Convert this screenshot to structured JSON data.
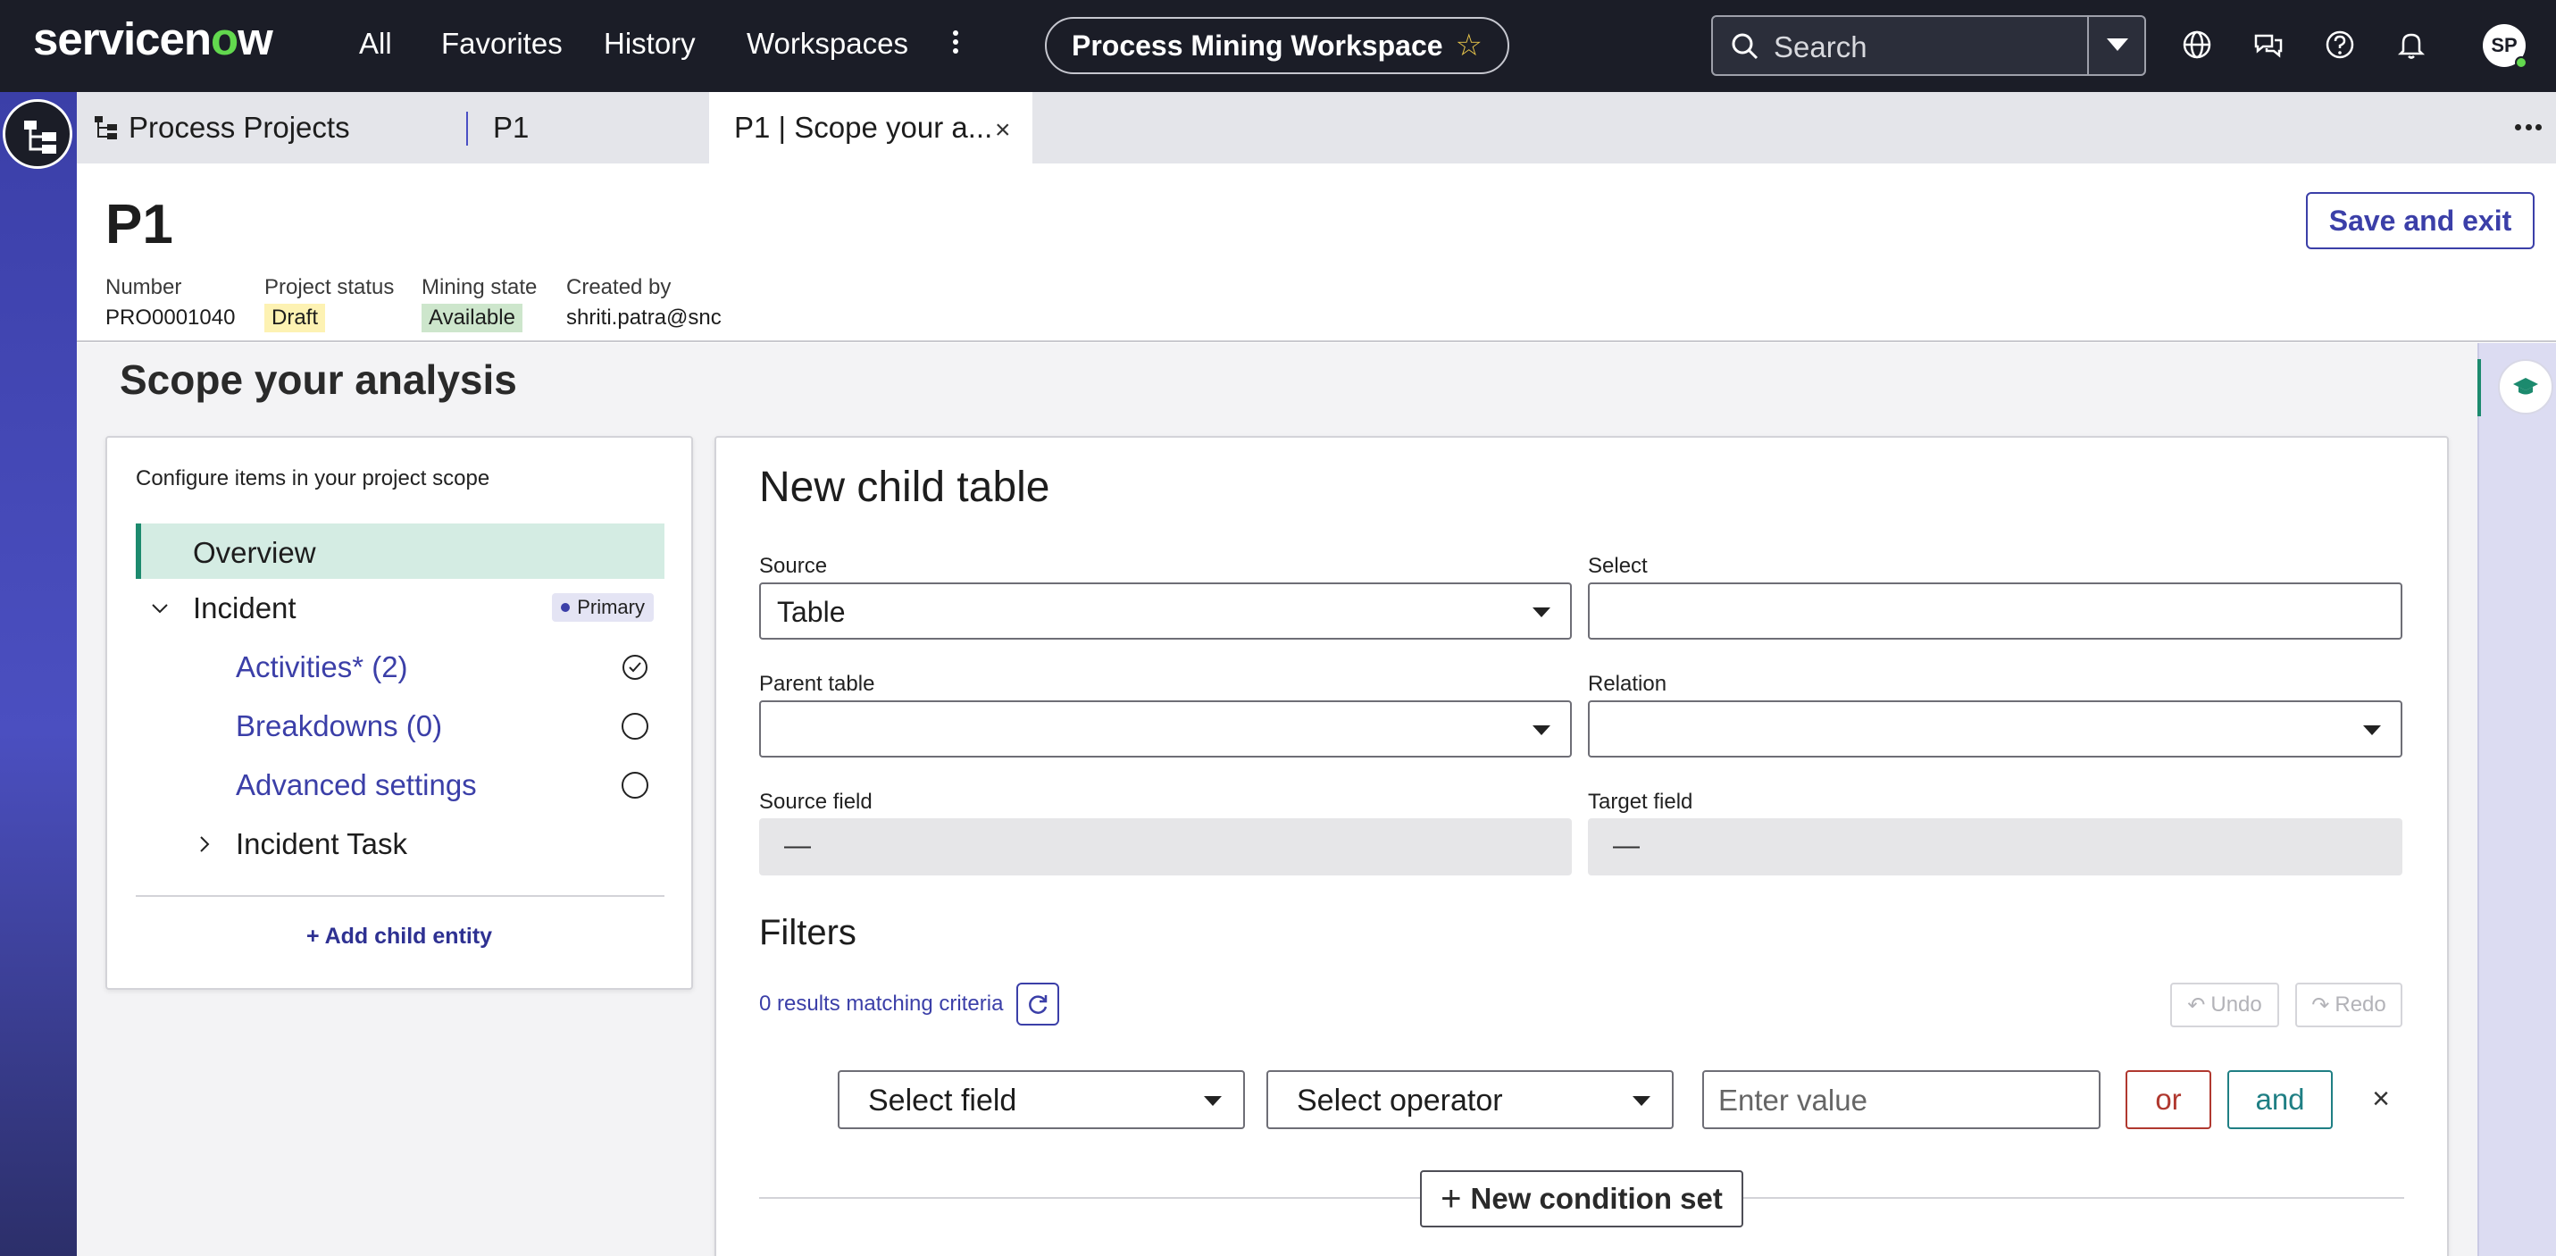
{
  "topbar": {
    "logo": "servicenow",
    "nav": [
      "All",
      "Favorites",
      "History",
      "Workspaces"
    ],
    "workspace_pill": "Process Mining Workspace",
    "search_placeholder": "Search",
    "avatar_initials": "SP",
    "icons": [
      "globe-icon",
      "chat-icon",
      "help-icon",
      "bell-icon"
    ]
  },
  "tabs": [
    {
      "label": "Process Projects",
      "closable": false,
      "active": false
    },
    {
      "label": "P1",
      "closable": true,
      "active": false
    },
    {
      "label": "P1 | Scope your a...",
      "closable": true,
      "active": true
    }
  ],
  "record": {
    "title": "P1",
    "fields": [
      {
        "label": "Number",
        "value": "PRO0001040"
      },
      {
        "label": "Project status",
        "value": "Draft"
      },
      {
        "label": "Mining state",
        "value": "Available"
      },
      {
        "label": "Created by",
        "value": "shriti.patra@snc"
      }
    ],
    "save_label": "Save and exit"
  },
  "main": {
    "section_title": "Scope your analysis",
    "scope": {
      "caption": "Configure items in your project scope",
      "overview": "Overview",
      "incident": "Incident",
      "primary_badge": "Primary",
      "items": [
        {
          "label": "Activities* (2)",
          "status": "complete"
        },
        {
          "label": "Breakdowns (0)",
          "status": "empty"
        },
        {
          "label": "Advanced settings",
          "status": "empty"
        }
      ],
      "incident_task": "Incident Task",
      "add_child": "Add child entity"
    },
    "form": {
      "title": "New child table",
      "source_label": "Source",
      "source_value": "Table",
      "select_label": "Select",
      "select_value": "",
      "parent_label": "Parent table",
      "parent_value": "",
      "relation_label": "Relation",
      "relation_value": "",
      "source_field_label": "Source field",
      "source_field_value": "—",
      "target_field_label": "Target field",
      "target_field_value": "—"
    },
    "filters": {
      "title": "Filters",
      "results": "0 results matching criteria",
      "undo": "Undo",
      "redo": "Redo",
      "field_placeholder": "Select field",
      "operator_placeholder": "Select operator",
      "value_placeholder": "Enter value",
      "or_label": "or",
      "and_label": "and",
      "new_condition_set": "New condition set"
    }
  },
  "colors": {
    "topbar": "#1b1d27",
    "accent": "#3b3fa8",
    "green": "#1c8a6e",
    "draft_badge": "#fdf2b3",
    "available_badge": "#cde6cc"
  }
}
